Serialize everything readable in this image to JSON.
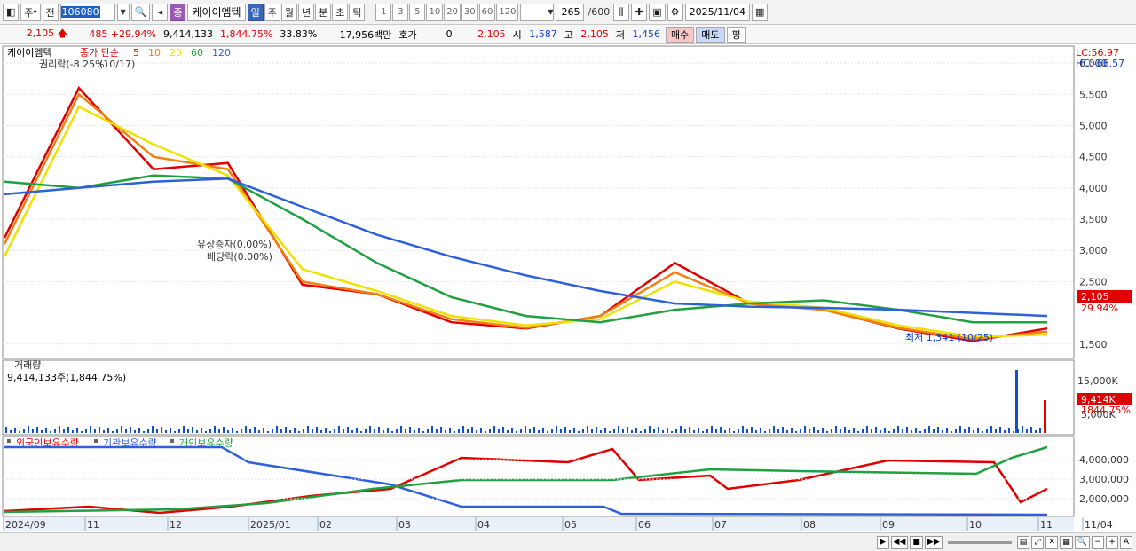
{
  "toolbar": {
    "period_week": "주",
    "prev": "전",
    "stock_code": "106080",
    "stock_name": "케이이엠텍",
    "purple_tag": "종",
    "tabs": [
      "일",
      "주",
      "월",
      "년",
      "분",
      "초",
      "틱"
    ],
    "active_tab": "일",
    "intervals": [
      "1",
      "3",
      "5",
      "10",
      "20",
      "30",
      "60",
      "120"
    ],
    "count_value": "265",
    "count_total": "/600",
    "date_value": "2025/11/04"
  },
  "quote": {
    "price": "2,105",
    "change": "485",
    "change_pct": "+29.94%",
    "volume": "9,414,133",
    "volume_pct": "1,844.75%",
    "turnover": "33.83%",
    "amount": "17,956백만",
    "hoga_label": "호가",
    "hoga_value": "0",
    "open_price": "2,105",
    "open_label": "시",
    "open_value": "1,587",
    "high_label": "고",
    "high_value": "2,105",
    "low_label": "저",
    "low_value": "1,456",
    "buy_label": "매수",
    "sell_label": "매도",
    "eval_label": "평"
  },
  "price_panel": {
    "legend_name": "케이이엠텍",
    "legend_ma": "종가 단순",
    "ma_periods": [
      "5",
      "10",
      "20",
      "60",
      "120"
    ],
    "ma_colors": [
      "#e00000",
      "#f08010",
      "#f0e000",
      "#20a040",
      "#3060d8"
    ],
    "annotation_top": "권리락(-8.25%)",
    "annotation_top2": "(10/17)",
    "annotation_mid1": "유상증자(0.00%)",
    "annotation_mid2": "배당락(0.00%)",
    "low_marker": "최저 1,341 (10/25)",
    "lc_label": "LC:56.97",
    "hc_label": "HC:-66.57",
    "price_axis": [
      "6,000",
      "5,500",
      "5,000",
      "4,500",
      "4,000",
      "3,500",
      "3,000",
      "2,500",
      "1,500"
    ],
    "current_tag": "2,105",
    "current_pct": "29.94%"
  },
  "volume_panel": {
    "title": "거래량",
    "value_text": "9,414,133주(1,844.75%)",
    "axis": [
      "15,000K"
    ],
    "tag": "9,414K",
    "tag_pct": "1844.75%",
    "under_tag": "5,000K"
  },
  "holding_panel": {
    "legend": [
      "외국인보유수량",
      "기관보유수량",
      "개인보유수량"
    ],
    "colors": [
      "#e00000",
      "#3060d8",
      "#20a040"
    ],
    "axis": [
      "4,000,000",
      "3,000,000",
      "2,000,000"
    ]
  },
  "x_axis": [
    "2024/09",
    "11",
    "12",
    "2025/01",
    "02",
    "03",
    "04",
    "05",
    "06",
    "07",
    "08",
    "09",
    "10",
    "11",
    "11/04"
  ],
  "chart_data": {
    "type": "line",
    "title": "",
    "x": [
      "2024/09",
      "10",
      "11",
      "12",
      "2025/01",
      "02",
      "03",
      "04",
      "05",
      "06",
      "07",
      "08",
      "09",
      "10",
      "11/04"
    ],
    "series": [
      {
        "name": "5",
        "values": [
          3200,
          5600,
          4300,
          4400,
          2450,
          2300,
          1850,
          1750,
          1950,
          2800,
          2150,
          2050,
          1750,
          1550,
          1750
        ]
      },
      {
        "name": "10",
        "values": [
          3100,
          5500,
          4500,
          4300,
          2500,
          2300,
          1900,
          1760,
          1950,
          2650,
          2150,
          2050,
          1760,
          1580,
          1700
        ]
      },
      {
        "name": "20",
        "values": [
          2900,
          5300,
          4700,
          4200,
          2700,
          2350,
          1950,
          1800,
          1900,
          2500,
          2180,
          2080,
          1800,
          1620,
          1650
        ]
      },
      {
        "name": "60",
        "values": [
          4100,
          4000,
          4200,
          4150,
          3500,
          2800,
          2250,
          1950,
          1850,
          2050,
          2150,
          2200,
          2050,
          1850,
          1850
        ]
      },
      {
        "name": "120",
        "values": [
          3900,
          4000,
          4100,
          4150,
          3700,
          3250,
          2900,
          2600,
          2350,
          2150,
          2100,
          2080,
          2050,
          2000,
          1950
        ]
      }
    ],
    "ylim": [
      1341,
      6200
    ],
    "price_low": 1341
  }
}
